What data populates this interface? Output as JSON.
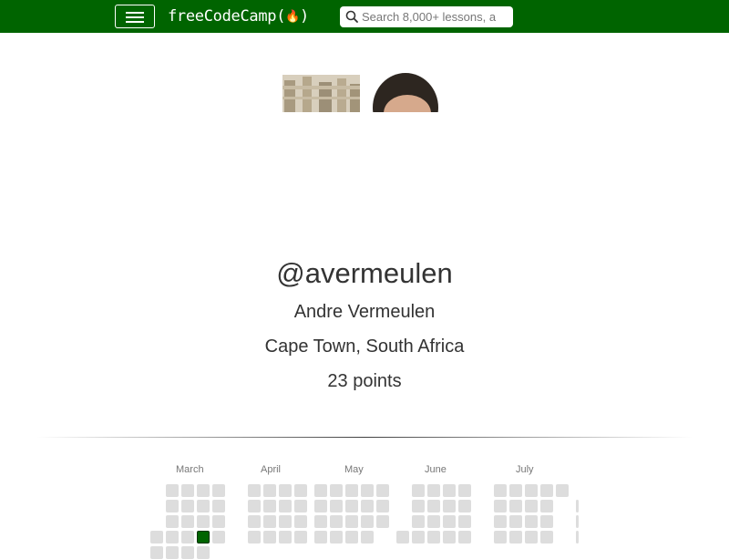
{
  "navbar": {
    "menu_label": "Menu",
    "logo_text": "freeCodeCamp(",
    "logo_flame": "🔥",
    "logo_close": ")",
    "search_placeholder": "Search 8,000+ lessons, a"
  },
  "profile": {
    "username": "@avermeulen",
    "name": "Andre Vermeulen",
    "location": "Cape Town, South Africa",
    "points": "23 points"
  },
  "heatmap": {
    "months": [
      "March",
      "April",
      "May",
      "June",
      "July"
    ],
    "active_color": "#006400",
    "empty_color": "#dddddd"
  },
  "colors": {
    "brand": "#006400",
    "text": "#333333"
  }
}
